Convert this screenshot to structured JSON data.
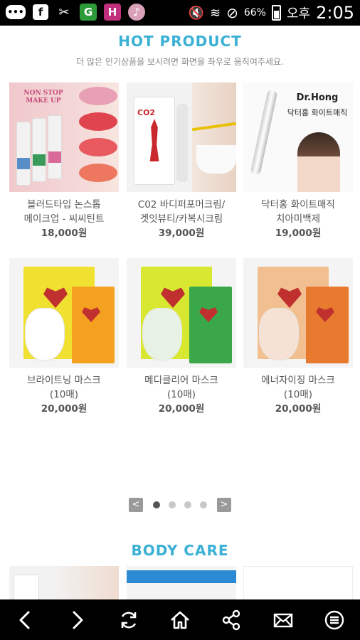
{
  "status_bar": {
    "battery_level": "66%",
    "am_pm": "오후",
    "time": "2:05"
  },
  "hot_product": {
    "title": "HOT PRODUCT",
    "hint": "더 많은 인기상품을 보시려면 화면을 좌우로 움직여주세요.",
    "products": [
      {
        "name_line1": "블러드타입 논스톱",
        "name_line2": "메이크업 - 씨씨틴트",
        "price": "18,000원",
        "image_text": "NON STOP MAKE UP"
      },
      {
        "name_line1": "C02 바디퍼포머크림/",
        "name_line2": "겟잇뷰티/카복시크림",
        "price": "39,000원",
        "image_text": "CO2"
      },
      {
        "name_line1": "닥터홍 화이트매직",
        "name_line2": "치아미백제",
        "price": "19,000원",
        "image_text_brand": "Dr.Hong",
        "image_text_sub": "닥터홍 화이트매직"
      },
      {
        "name_line1": "브라이트닝 마스크",
        "name_line2": "(10매)",
        "price": "20,000원"
      },
      {
        "name_line1": "메디클리어 마스크",
        "name_line2": "(10매)",
        "price": "20,000원"
      },
      {
        "name_line1": "에너자이징 마스크",
        "name_line2": "(10매)",
        "price": "20,000원"
      }
    ],
    "pager": {
      "prev": "<",
      "next": ">",
      "pages": 4,
      "current": 1
    }
  },
  "body_care": {
    "title": "BODY CARE"
  },
  "colors": {
    "accent": "#3ab0d4",
    "statusbar": "#000000"
  },
  "icons": [
    "back-icon",
    "forward-icon",
    "refresh-icon",
    "home-icon",
    "share-icon",
    "mail-icon",
    "menu-icon"
  ]
}
